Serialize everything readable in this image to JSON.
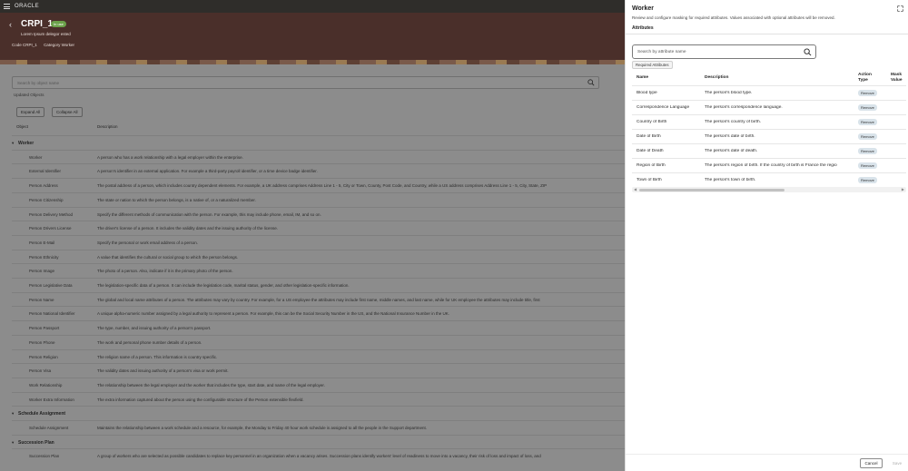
{
  "app": {
    "brand": "ORACLE"
  },
  "hero": {
    "title": "CRPI_1",
    "badge": "In use",
    "subtitle": "Lorem Ipsum delegor ested",
    "meta": [
      {
        "label": "Code",
        "value": "CRPI_1"
      },
      {
        "label": "Category",
        "value": "Worker"
      }
    ]
  },
  "main": {
    "search_placeholder": "Search by object name",
    "updated_label": "Updated Objects",
    "expand_all": "Expand All",
    "collapse_all": "Collapse All",
    "columns": {
      "object": "Object",
      "description": "Description"
    },
    "groups": [
      {
        "label": "Worker",
        "rows": [
          {
            "name": "Worker",
            "desc": "A person who has a work relationship with a legal employer within the enterprise."
          },
          {
            "name": "External Identifier",
            "desc": "A person's identifier in an external application. For example a third-party payroll identifier, or a time device badge identifier."
          },
          {
            "name": "Person Address",
            "desc": "The postal address of a person, which includes country dependent elements. For example, a UK address comprises Address Line 1 - 5, City or Town, County, Post Code, and Country, while a US address comprises Address Line 1 - 5, City, State, ZIP"
          },
          {
            "name": "Person Citizenship",
            "desc": "The state or nation to which the person belongs, is a native of, or a naturalized member."
          },
          {
            "name": "Person Delivery Method",
            "desc": "Specify the different methods of communication with the person. For example, this may include phone, email, IM, and so on."
          },
          {
            "name": "Person Drivers License",
            "desc": "The driver's license of a person. It includes the validity dates and the issuing authority of the license."
          },
          {
            "name": "Person E-Mail",
            "desc": "Specify the personal or work email address of a person."
          },
          {
            "name": "Person Ethnicity",
            "desc": "A value that identifies the cultural or social group to which the person belongs."
          },
          {
            "name": "Person Image",
            "desc": "The photo of a person. Also, indicate if it is the primary photo of the person."
          },
          {
            "name": "Person Legislative Data",
            "desc": "The legislation-specific data of a person. It can include the legislation code, marital status, gender, and other legislation-specific information."
          },
          {
            "name": "Person Name",
            "desc": "The global and local name attributes of a person. The attributes may vary by country. For example, for a US employee the attributes may include first name, middle names, and last name, while for UK employee the attributes may include title, first"
          },
          {
            "name": "Person National Identifier",
            "desc": "A unique alpha-numeric number assigned by a legal authority to represent a person. For example, this can be the Social Security Number in the US, and the National Insurance Number in the UK."
          },
          {
            "name": "Person Passport",
            "desc": "The type, number, and issuing authority of a person's passport."
          },
          {
            "name": "Person Phone",
            "desc": "The work and personal phone number details of a person."
          },
          {
            "name": "Person Religion",
            "desc": "The religion name of a person. This information is country specific."
          },
          {
            "name": "Person Visa",
            "desc": "The validity dates and issuing authority of a person's visa or work permit."
          },
          {
            "name": "Work Relationship",
            "desc": "The relationship between the legal employer and the worker that includes the type, start date, and name of the legal employer."
          },
          {
            "name": "Worker Extra Information",
            "desc": "The extra information captured about the person using the configurable structure of the Person extensible flexfield."
          }
        ]
      },
      {
        "label": "Schedule Assignment",
        "rows": [
          {
            "name": "Schedule Assignment",
            "desc": "Maintains the relationship between a work schedule and a resource, for example, the Monday to Friday 40 hour work schedule is assigned to all the people in the Support department."
          }
        ]
      },
      {
        "label": "Succession Plan",
        "rows": [
          {
            "name": "Succession Plan",
            "desc": "A group of workers who are selected as possible candidates to replace key personnel in an organization when a vacancy arises. Succession plans identify workers' level of readiness to move into a vacancy, their risk of loss and impact of loss, and"
          }
        ]
      }
    ]
  },
  "drawer": {
    "title": "Worker",
    "description": "Review and configure masking for required attributes. Values associated with optional attributes will be removed.",
    "tab": "Attributes",
    "search_placeholder": "Search by attribute name",
    "filter_chip": "Required Attributes",
    "columns": {
      "name": "Name",
      "description": "Description",
      "action": "Action Type",
      "mask": "Mask Value"
    },
    "rows": [
      {
        "name": "Blood type",
        "desc": "The person's blood type.",
        "action": "Remove"
      },
      {
        "name": "Correspondence Language",
        "desc": "The person's correspondence language.",
        "action": "Remove"
      },
      {
        "name": "Country of Birth",
        "desc": "The person's country of birth.",
        "action": "Remove"
      },
      {
        "name": "Date of Birth",
        "desc": "The person's date of birth.",
        "action": "Remove"
      },
      {
        "name": "Date of Death",
        "desc": "The person's date of death.",
        "action": "Remove"
      },
      {
        "name": "Region of Birth",
        "desc": "The person's region of birth. If the country of birth is France the regio",
        "action": "Remove"
      },
      {
        "name": "Town of Birth",
        "desc": "The person's town of birth.",
        "action": "Remove"
      }
    ],
    "cancel": "Cancel",
    "save": "Save"
  }
}
